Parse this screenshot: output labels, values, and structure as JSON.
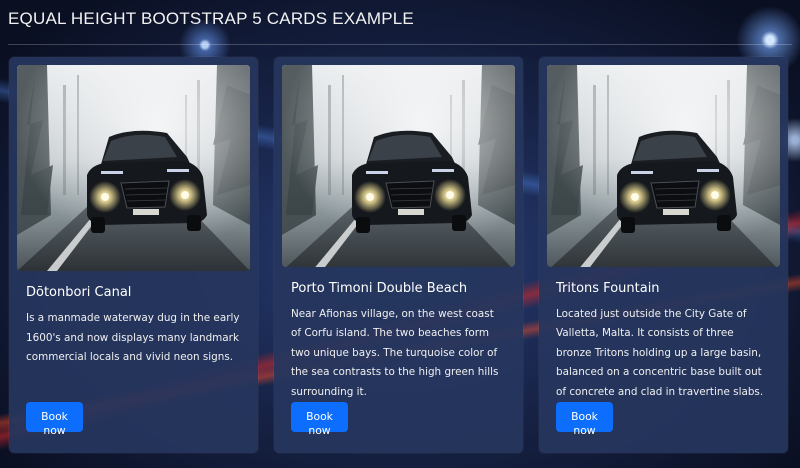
{
  "header": {
    "title": "EQUAL HEIGHT BOOTSTRAP 5 CARDS EXAMPLE"
  },
  "colors": {
    "button": "#0d6efd",
    "card_bg": "#26365e"
  },
  "cards": [
    {
      "title": "Dōtonbori Canal",
      "text": "Is a manmade waterway dug in the early 1600's and now displays many landmark commercial locals and vivid neon signs.",
      "button_label": "Book now",
      "image_icon": "car-in-fog-image"
    },
    {
      "title": "Porto Timoni Double Beach",
      "text": "Near Afionas village, on the west coast of Corfu island. The two beaches form two unique bays. The turquoise color of the sea contrasts to the high green hills surrounding it.",
      "button_label": "Book now",
      "image_icon": "car-in-fog-image"
    },
    {
      "title": "Tritons Fountain",
      "text": "Located just outside the City Gate of Valletta, Malta. It consists of three bronze Tritons holding up a large basin, balanced on a concentric base built out of concrete and clad in travertine slabs.",
      "button_label": "Book now",
      "image_icon": "car-in-fog-image"
    }
  ]
}
